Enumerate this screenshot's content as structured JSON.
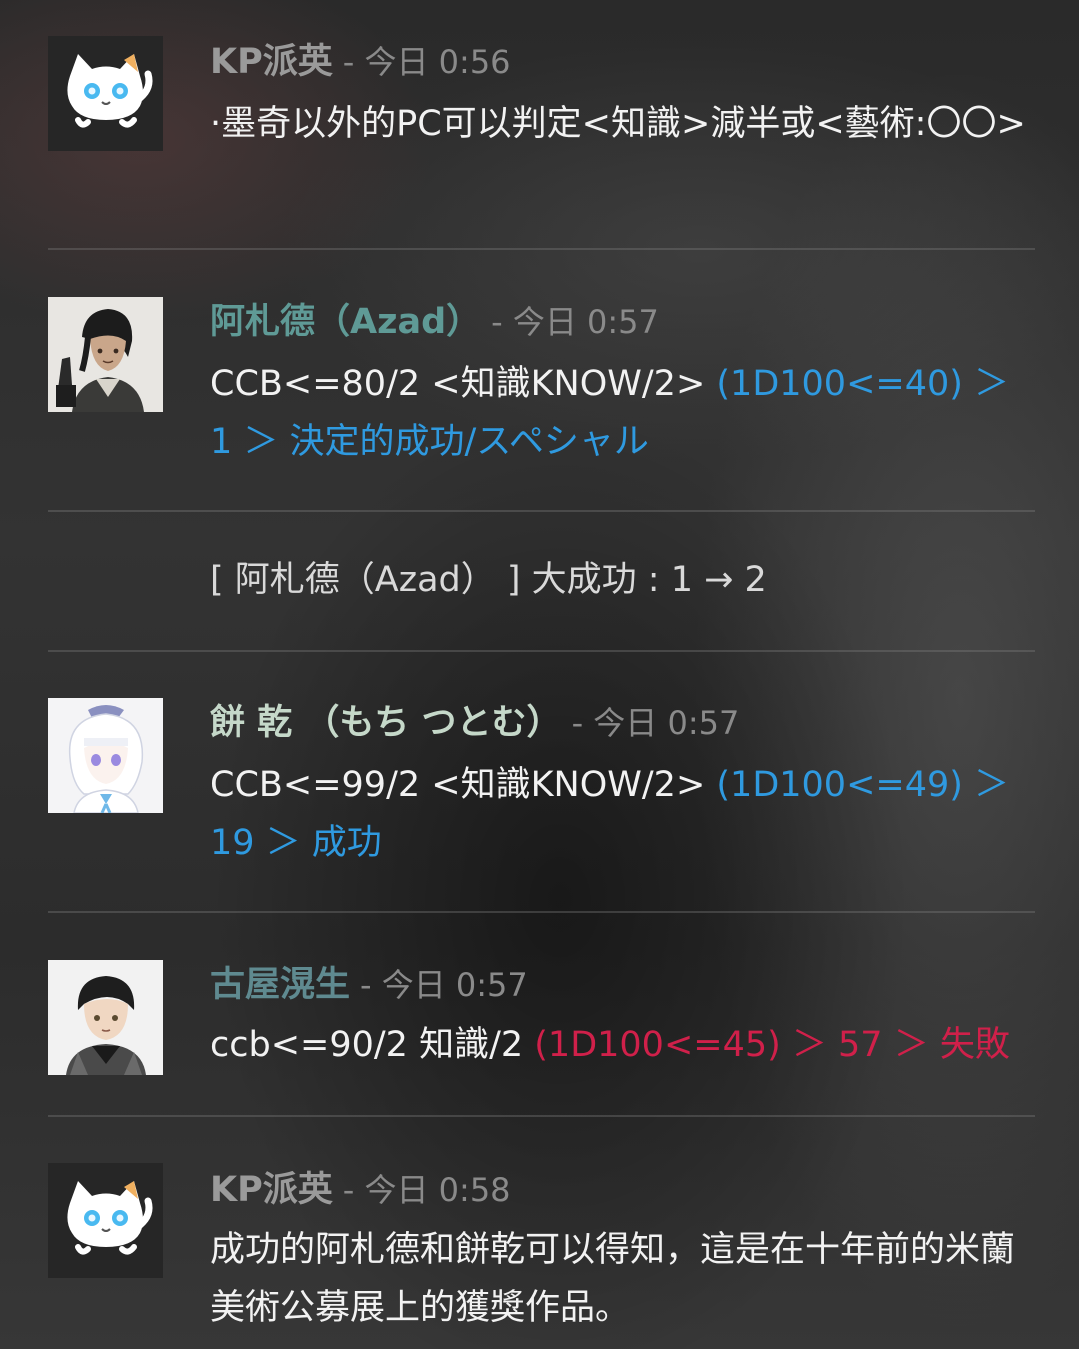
{
  "messages": [
    {
      "name": "KP派英",
      "name_color": "#9a9a9a",
      "time": "- 今日 0:56",
      "text": "·墨奇以外的PC可以判定<知識>減半或<藝術:〇〇>"
    },
    {
      "name": "阿札德（Azad）",
      "name_color": "#5f9a96",
      "time": "- 今日 0:57",
      "command": "CCB<=80/2 <知識KNOW/2> ",
      "result": "(1D100<=40) ＞ 1 ＞ 決定的成功/スペシャル",
      "result_color": "#2f9ae0"
    },
    {
      "system": "[ 阿札德（Azad） ] 大成功 : 1 → 2"
    },
    {
      "name": "餅 乾 （もち つとむ）",
      "name_color": "#c5d8c9",
      "time": "- 今日 0:57",
      "command": "CCB<=99/2 <知識KNOW/2> ",
      "result": "(1D100<=49) ＞ 19 ＞ 成功",
      "result_color": "#2f9ae0"
    },
    {
      "name": "古屋滉生",
      "name_color": "#5f8a90",
      "time": "- 今日 0:57",
      "command": "ccb<=90/2 知識/2 ",
      "result": "(1D100<=45) ＞ 57 ＞ 失敗",
      "result_color": "#d0204a"
    },
    {
      "name": "KP派英",
      "name_color": "#9a9a9a",
      "time": "- 今日 0:58",
      "text": "成功的阿札德和餅乾可以得知，這是在十年前的米蘭美術公募展上的獲獎作品。"
    }
  ],
  "icons": {
    "cat_avatar": "white-cat-avatar-icon",
    "azad_avatar": "dark-haired-character-avatar-icon",
    "mochi_avatar": "white-haired-character-avatar-icon",
    "furuya_avatar": "black-haired-character-avatar-icon"
  }
}
